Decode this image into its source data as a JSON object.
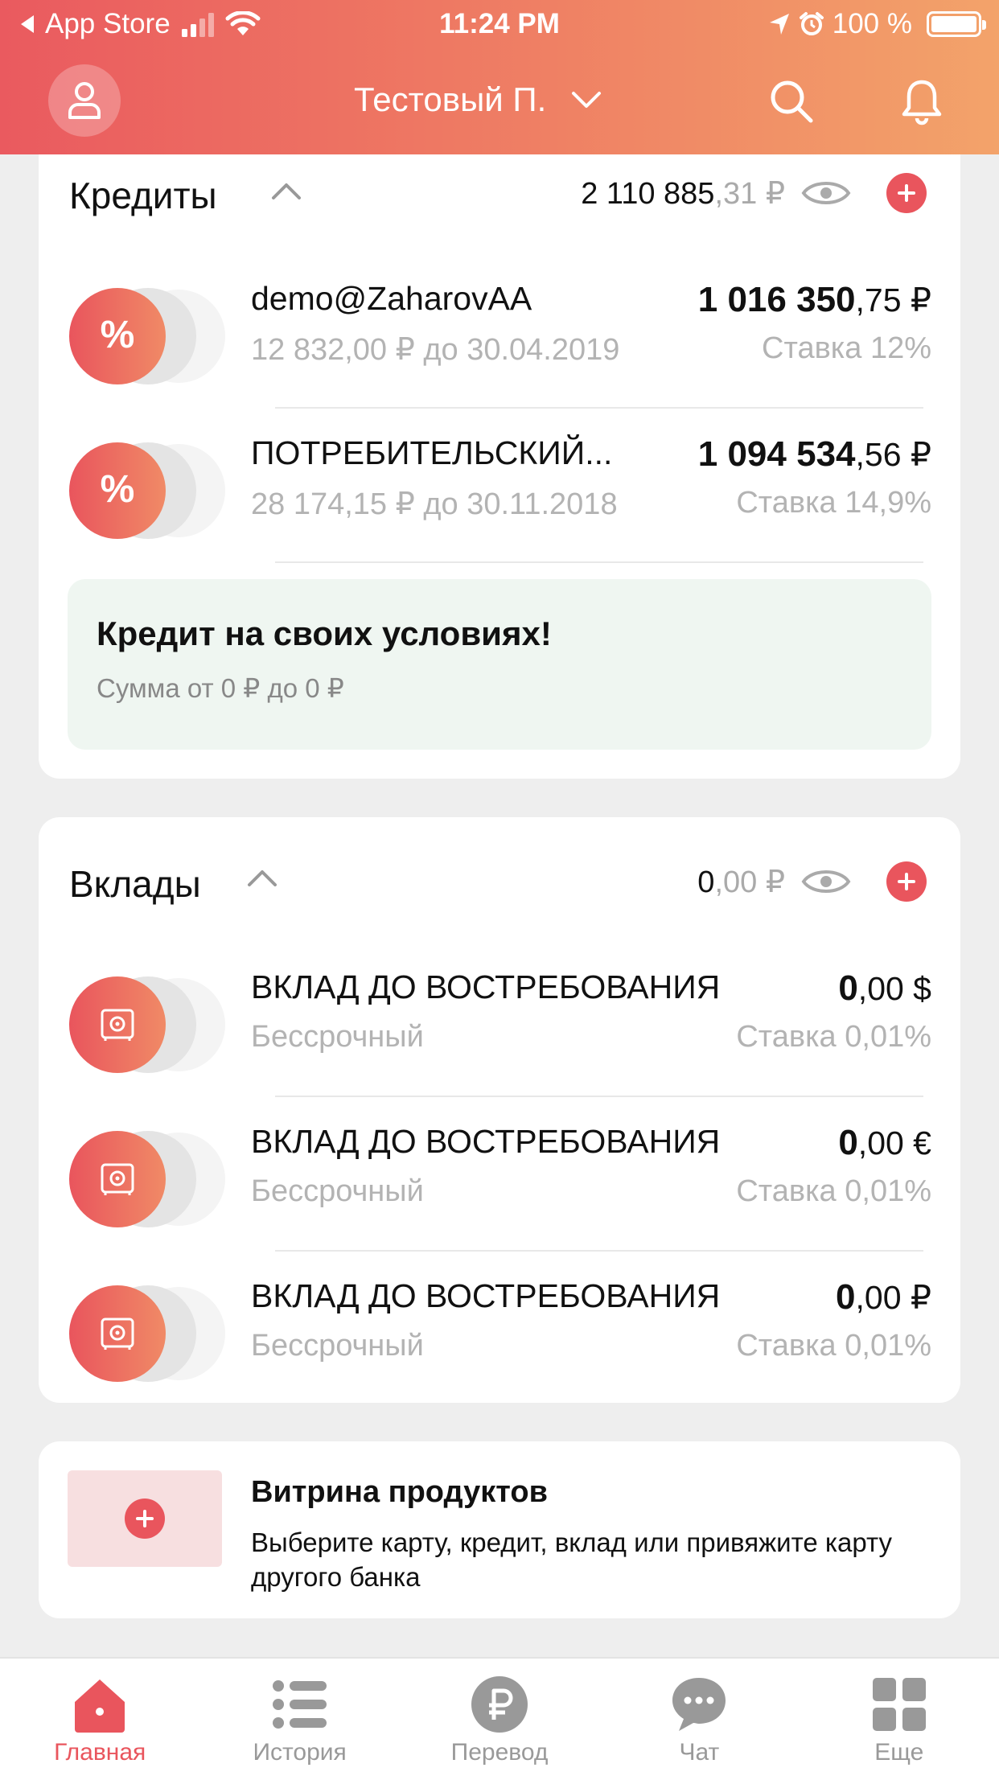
{
  "status_bar": {
    "back_label": "App Store",
    "time": "11:24 PM",
    "battery": "100 %"
  },
  "header": {
    "profile_name": "Тестовый П."
  },
  "credits": {
    "title": "Кредиты",
    "total_int": "2 110 885",
    "total_frac": ",31 ₽",
    "items": [
      {
        "name": "demo@ZaharovAA",
        "sub": "12 832,00 ₽ до 30.04.2019",
        "amount_int": "1 016 350",
        "amount_frac": ",75 ₽",
        "rate": "Ставка 12%",
        "icon": "percent-icon"
      },
      {
        "name": "ПОТРЕБИТЕЛЬСКИЙ...",
        "sub": "28 174,15 ₽ до 30.11.2018",
        "amount_int": "1 094 534",
        "amount_frac": ",56 ₽",
        "rate": "Ставка 14,9%",
        "icon": "percent-icon"
      }
    ],
    "promo": {
      "title": "Кредит на своих условиях!",
      "subtitle": "Сумма от 0 ₽ до 0 ₽"
    }
  },
  "deposits": {
    "title": "Вклады",
    "total_int": "0",
    "total_frac": ",00 ₽",
    "items": [
      {
        "name": "ВКЛАД ДО ВОСТРЕБОВАНИЯ",
        "sub": "Бессрочный",
        "amount_int": "0",
        "amount_frac": ",00 $",
        "rate": "Ставка 0,01%",
        "icon": "safe-icon"
      },
      {
        "name": "ВКЛАД ДО ВОСТРЕБОВАНИЯ",
        "sub": "Бессрочный",
        "amount_int": "0",
        "amount_frac": ",00 €",
        "rate": "Ставка 0,01%",
        "icon": "safe-icon"
      },
      {
        "name": "ВКЛАД ДО ВОСТРЕБОВАНИЯ",
        "sub": "Бессрочный",
        "amount_int": "0",
        "amount_frac": ",00 ₽",
        "rate": "Ставка 0,01%",
        "icon": "safe-icon"
      }
    ]
  },
  "showcase": {
    "title": "Витрина продуктов",
    "text": "Выберите карту, кредит, вклад или привяжите карту другого банка"
  },
  "tabbar": {
    "tabs": [
      {
        "label": "Главная",
        "icon": "home-icon",
        "active": true
      },
      {
        "label": "История",
        "icon": "list-icon",
        "active": false
      },
      {
        "label": "Перевод",
        "icon": "ruble-icon",
        "active": false
      },
      {
        "label": "Чат",
        "icon": "chat-icon",
        "active": false
      },
      {
        "label": "Еще",
        "icon": "grid-icon",
        "active": false
      }
    ]
  },
  "colors": {
    "accent": "#e9555d",
    "header_start": "#ea5a5f",
    "header_end": "#f3a36a",
    "promo_bg": "#eff6f1"
  }
}
